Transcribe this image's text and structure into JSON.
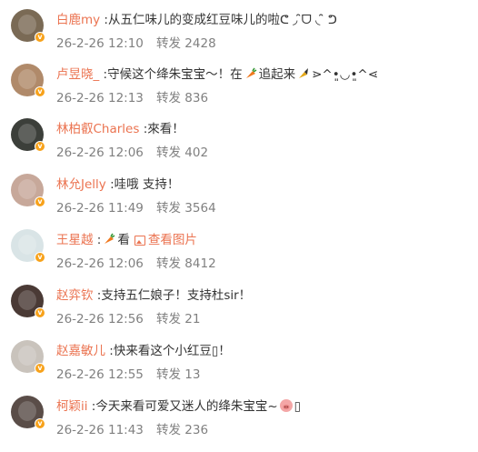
{
  "colors": {
    "username": "#eb7350",
    "meta": "#808080",
    "text": "#333333",
    "badge": "#f7a21b"
  },
  "comments": [
    {
      "user": "白鹿my",
      "sep": " :",
      "text": "从五仁味儿的变成红豆味儿的啦ᕦ ◞ ̑̑ᗜ ◟ ̑̑ ᕤ",
      "date": "26-2-26 12:10",
      "repost_label": "转发",
      "reposts": "2428",
      "avatar_icon": "avatar-photo"
    },
    {
      "user": "卢昱晓_",
      "sep": " :",
      "text": "守候这个绛朱宝宝～！在",
      "text2": "追起来",
      "text3": "⋗^•͈◡•͈^⋖",
      "date": "26-2-26 12:13",
      "repost_label": "转发",
      "reposts": "836",
      "avatar_icon": "avatar-photo"
    },
    {
      "user": "林柏叡Charles",
      "sep": " :",
      "text": "來看！",
      "date": "26-2-26 12:06",
      "repost_label": "转发",
      "reposts": "402",
      "avatar_icon": "avatar-photo"
    },
    {
      "user": "林允Jelly",
      "sep": " :",
      "text": "哇哦 支持！",
      "date": "26-2-26 11:49",
      "repost_label": "转发",
      "reposts": "3564",
      "avatar_icon": "avatar-photo"
    },
    {
      "user": "王星越",
      "sep": " :",
      "text": "看",
      "view_pic": "查看图片",
      "date": "26-2-26 12:06",
      "repost_label": "转发",
      "reposts": "8412",
      "avatar_icon": "avatar-photo"
    },
    {
      "user": "赵弈钦",
      "sep": " :",
      "text": "支持五仁娘子！支持杜sir！",
      "date": "26-2-26 12:56",
      "repost_label": "转发",
      "reposts": "21",
      "avatar_icon": "avatar-photo"
    },
    {
      "user": "赵嘉敏儿",
      "sep": " :",
      "text": "快来看这个小红豆▯！",
      "date": "26-2-26 12:55",
      "repost_label": "转发",
      "reposts": "13",
      "avatar_icon": "avatar-photo"
    },
    {
      "user": "柯颖ii",
      "sep": " :",
      "text": "今天来看可爱又迷人的绛朱宝宝~",
      "text3": "▯",
      "date": "26-2-26 11:43",
      "repost_label": "转发",
      "reposts": "236",
      "avatar_icon": "avatar-photo"
    }
  ]
}
